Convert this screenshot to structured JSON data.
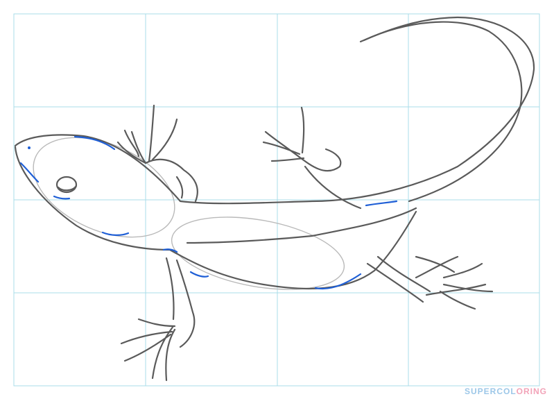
{
  "watermark": {
    "part1": "SUPERCOL",
    "part2": "ORING"
  },
  "colors": {
    "grid": "#a9dcea",
    "sketch": "#5a5a5a",
    "guide": "#b9b9b9",
    "accent": "#1f5fd6"
  }
}
